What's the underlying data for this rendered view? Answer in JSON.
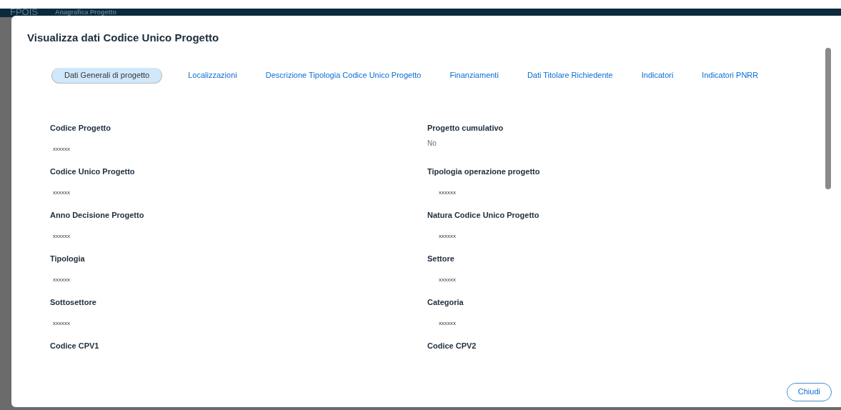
{
  "app_header": {
    "logo": "FPOIS",
    "title": "Anagrafica Progetto"
  },
  "dialog": {
    "title": "Visualizza dati Codice Unico Progetto",
    "tabs": [
      {
        "label": "Dati Generali di progetto",
        "selected": true
      },
      {
        "label": "Localizzazioni",
        "selected": false
      },
      {
        "label": "Descrizione Tipologia Codice Unico Progetto",
        "selected": false
      },
      {
        "label": "Finanziamenti",
        "selected": false
      },
      {
        "label": "Dati Titolare Richiedente",
        "selected": false
      },
      {
        "label": "Indicatori",
        "selected": false
      },
      {
        "label": "Indicatori PNRR",
        "selected": false
      }
    ],
    "fields": [
      {
        "label": "Codice Progetto",
        "value": "xxxxxx"
      },
      {
        "label": "Progetto cumulativo",
        "value": "No"
      },
      {
        "label": "Codice Unico Progetto",
        "value": "xxxxxx"
      },
      {
        "label": "Tipologia operazione progetto",
        "value": "xxxxxx"
      },
      {
        "label": "Anno Decisione Progetto",
        "value": "xxxxxx"
      },
      {
        "label": "Natura Codice Unico Progetto",
        "value": "xxxxxx"
      },
      {
        "label": "Tipologia",
        "value": "xxxxxx"
      },
      {
        "label": "Settore",
        "value": "xxxxxx"
      },
      {
        "label": "Sottosettore",
        "value": "xxxxxx"
      },
      {
        "label": "Categoria",
        "value": "xxxxxx"
      },
      {
        "label": "Codice CPV1"
      },
      {
        "label": "Codice CPV2"
      }
    ],
    "buttons": [
      "Chiudi"
    ]
  }
}
